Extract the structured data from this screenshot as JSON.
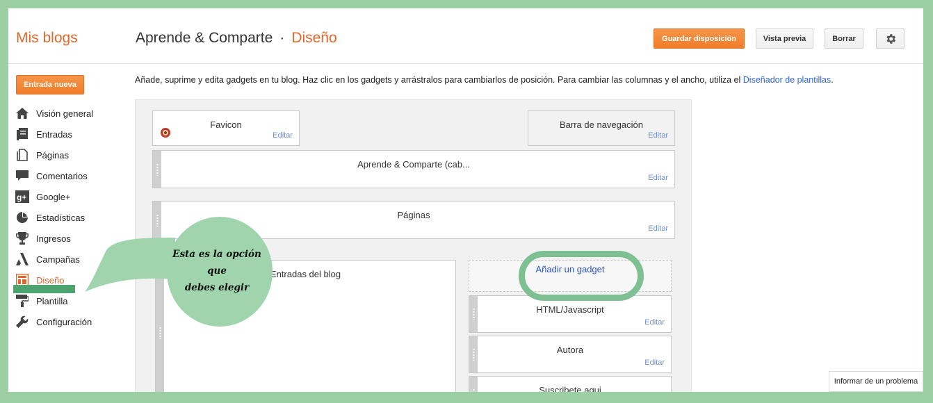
{
  "header": {
    "brand": "Mis blogs",
    "blog_name": "Aprende & Comparte",
    "separator": "·",
    "section": "Diseño",
    "buttons": {
      "save": "Guardar disposición",
      "preview": "Vista previa",
      "clear": "Borrar",
      "settings_icon": "gear-icon"
    }
  },
  "sidebar": {
    "new_post": "Entrada nueva",
    "items": [
      {
        "label": "Visión general",
        "icon": "home-icon"
      },
      {
        "label": "Entradas",
        "icon": "posts-icon"
      },
      {
        "label": "Páginas",
        "icon": "pages-icon"
      },
      {
        "label": "Comentarios",
        "icon": "comment-icon"
      },
      {
        "label": "Google+",
        "icon": "google-plus-icon"
      },
      {
        "label": "Estadísticas",
        "icon": "pie-chart-icon"
      },
      {
        "label": "Ingresos",
        "icon": "trophy-icon"
      },
      {
        "label": "Campañas",
        "icon": "adwords-icon"
      },
      {
        "label": "Diseño",
        "icon": "layout-icon",
        "active": true
      },
      {
        "label": "Plantilla",
        "icon": "paint-roller-icon"
      },
      {
        "label": "Configuración",
        "icon": "wrench-icon"
      }
    ]
  },
  "main": {
    "intro": "Añade, suprime y edita gadgets en tu blog. Haz clic en los gadgets y arrástralos para cambiarlos de posición. Para cambiar las columnas y el ancho, utiliza el",
    "intro_link": "Diseñador de plantillas",
    "intro_end": ".",
    "edit_label": "Editar",
    "gadgets": {
      "favicon": "Favicon",
      "navbar": "Barra de navegación",
      "header": "Aprende & Comparte (cab...",
      "pages": "Páginas",
      "blog_posts": "Entradas del blog",
      "add_gadget": "Añadir un gadget",
      "html": "HTML/Javascript",
      "author": "Autora",
      "subscribe": "Suscribete aqui"
    }
  },
  "callout": {
    "line1": "Esta es la opción",
    "line2": "que",
    "line3": "debes elegir"
  },
  "footer": {
    "report": "Informar de un problema"
  },
  "colors": {
    "accent": "#e0662b",
    "highlight": "#9fd4ad",
    "frame": "#9ccfa4"
  }
}
